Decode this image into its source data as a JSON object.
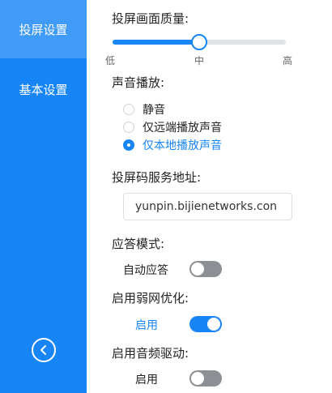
{
  "sidebar": {
    "items": [
      {
        "label": "投屏设置",
        "active": true
      },
      {
        "label": "基本设置",
        "active": false
      }
    ],
    "back_icon": "chevron-left-circle-icon"
  },
  "quality": {
    "label": "投屏画面质量:",
    "value_fraction": 0.5,
    "ticks": [
      "低",
      "中",
      "高"
    ]
  },
  "sound": {
    "label": "声音播放:",
    "options": [
      {
        "label": "静音",
        "checked": false
      },
      {
        "label": "仅远端播放声音",
        "checked": false
      },
      {
        "label": "仅本地播放声音",
        "checked": true
      }
    ]
  },
  "server": {
    "label": "投屏码服务地址:",
    "value": "yunpin.bijienetworks.con"
  },
  "answer_mode": {
    "label": "应答模式:",
    "toggle_label": "自动应答",
    "on": false
  },
  "weak_network": {
    "label": "启用弱网优化:",
    "toggle_label": "启用",
    "on": true
  },
  "audio_driver": {
    "label": "启用音频驱动:",
    "toggle_label": "启用",
    "on": false
  },
  "colors": {
    "accent": "#1785f5",
    "sidebar_active": "#3f9bf7",
    "toggle_off": "#8c8f94"
  }
}
